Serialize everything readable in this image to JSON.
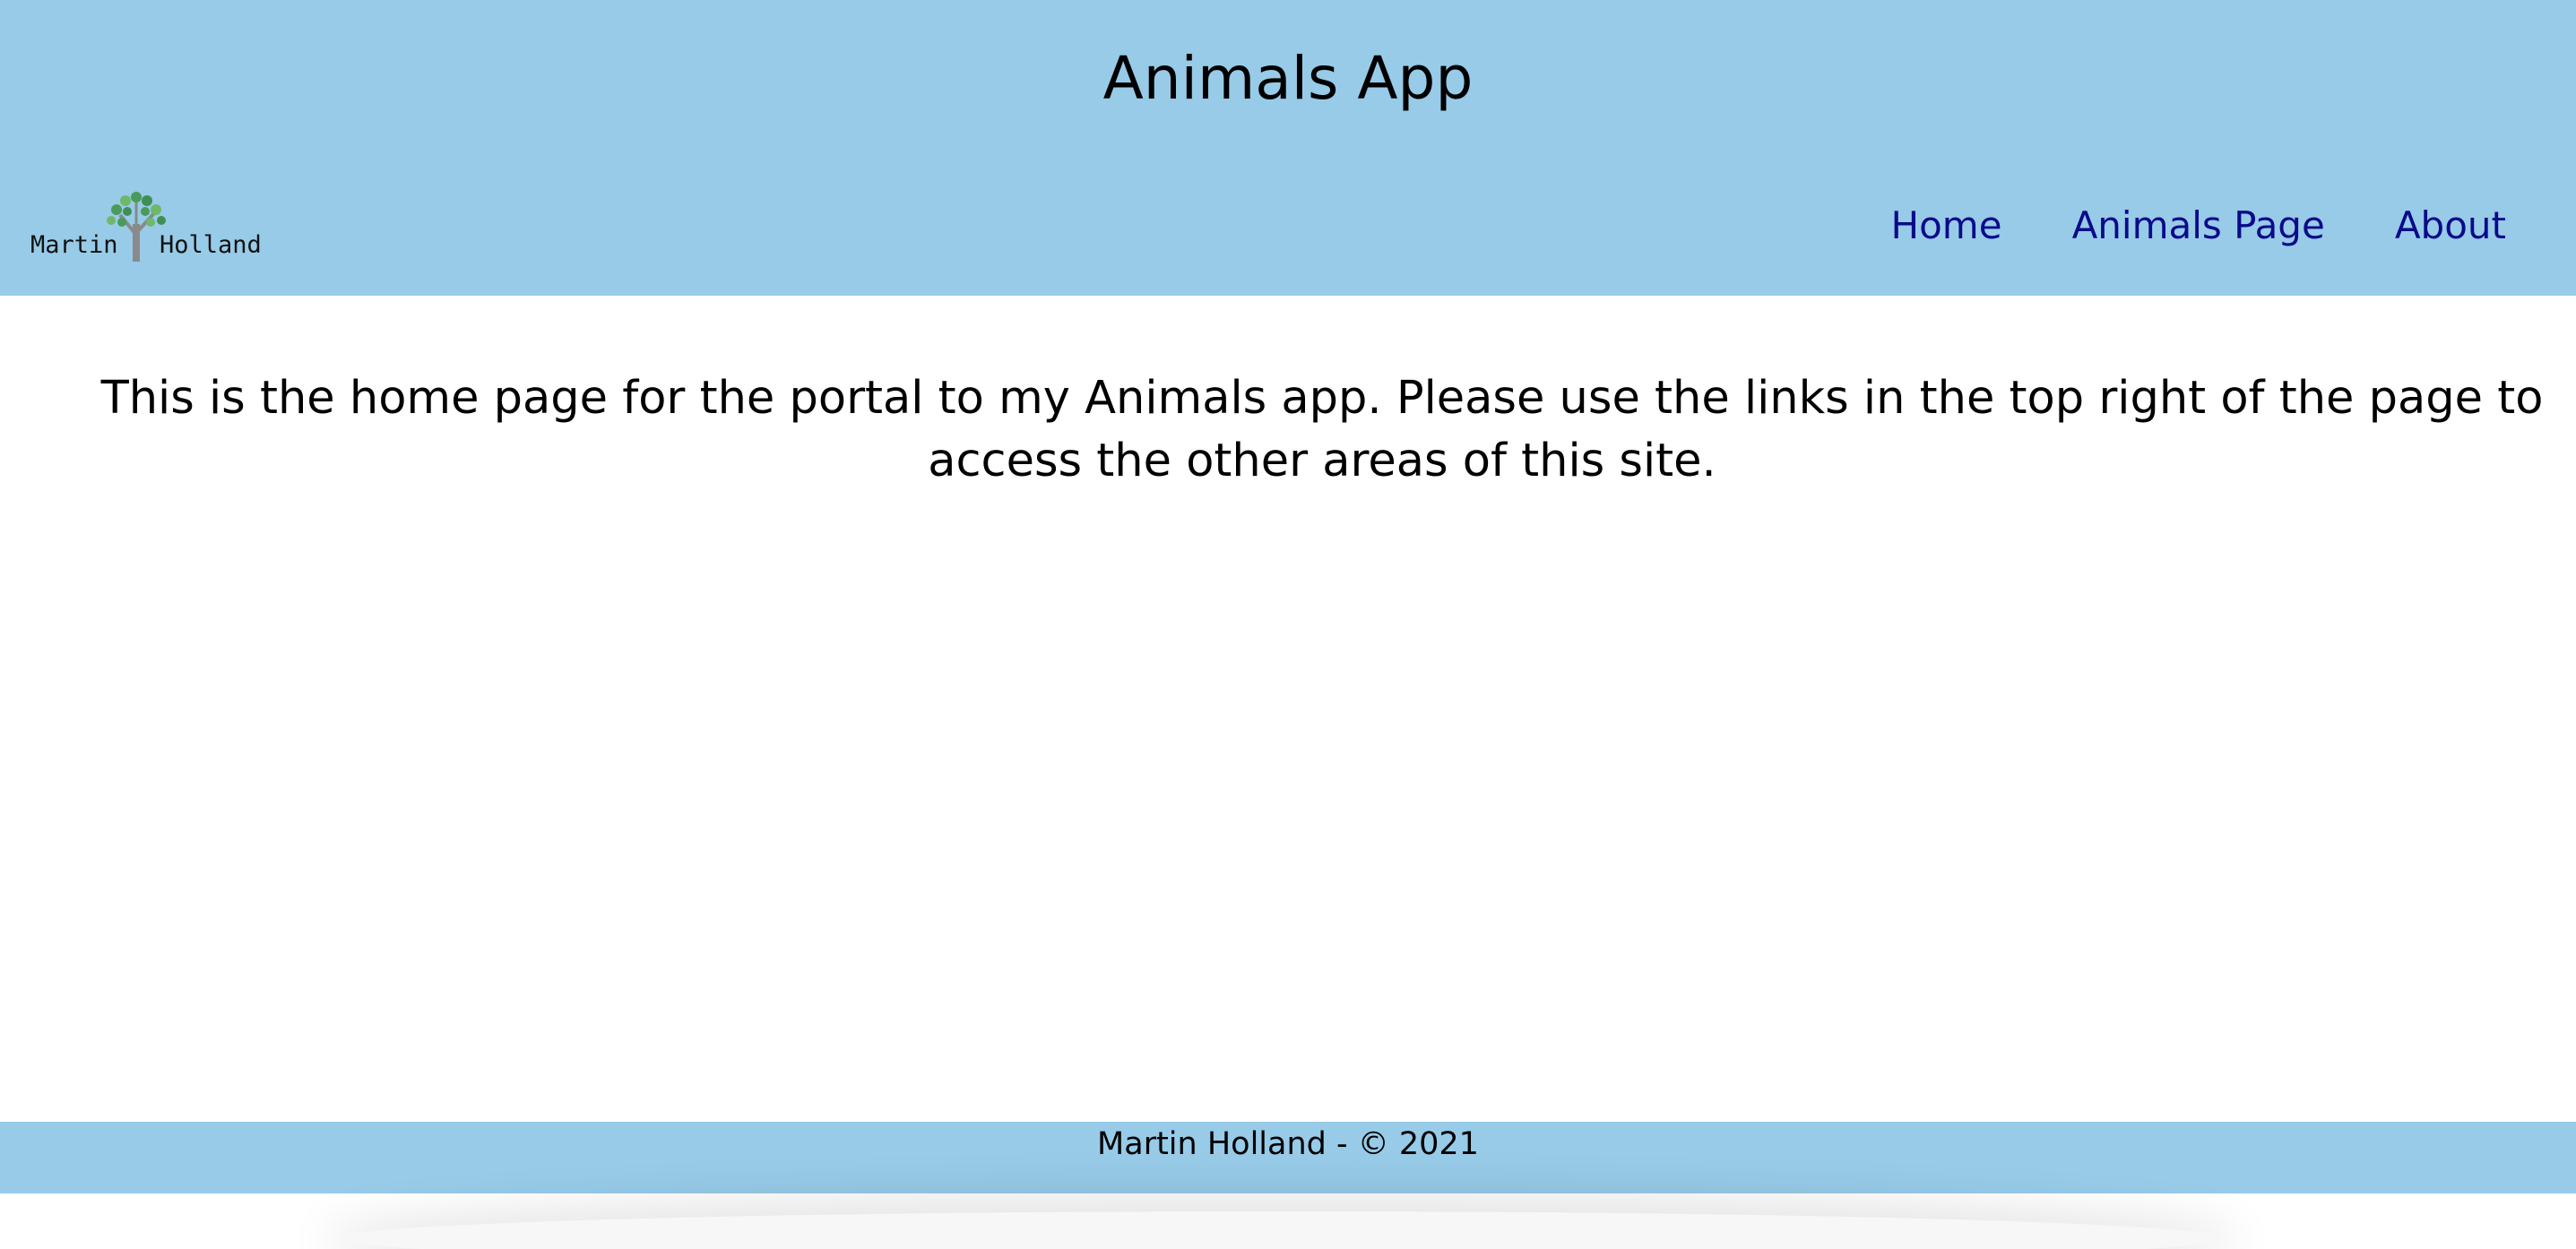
{
  "header": {
    "title": "Animals App",
    "logo": {
      "text_left": "Martin",
      "text_right": "Holland",
      "icon": "tree-icon"
    },
    "nav": [
      {
        "label": "Home"
      },
      {
        "label": "Animals Page"
      },
      {
        "label": "About"
      }
    ]
  },
  "main": {
    "intro": "This is the home page for the portal to my Animals app. Please use the links in the top right of the page to access the other areas of this site."
  },
  "footer": {
    "text": "Martin Holland - © 2021"
  },
  "colors": {
    "header_bg": "#97cbe8",
    "footer_bg": "#97cbe8",
    "nav_link": "#0a0a8a",
    "page_bg": "#ffffff"
  }
}
